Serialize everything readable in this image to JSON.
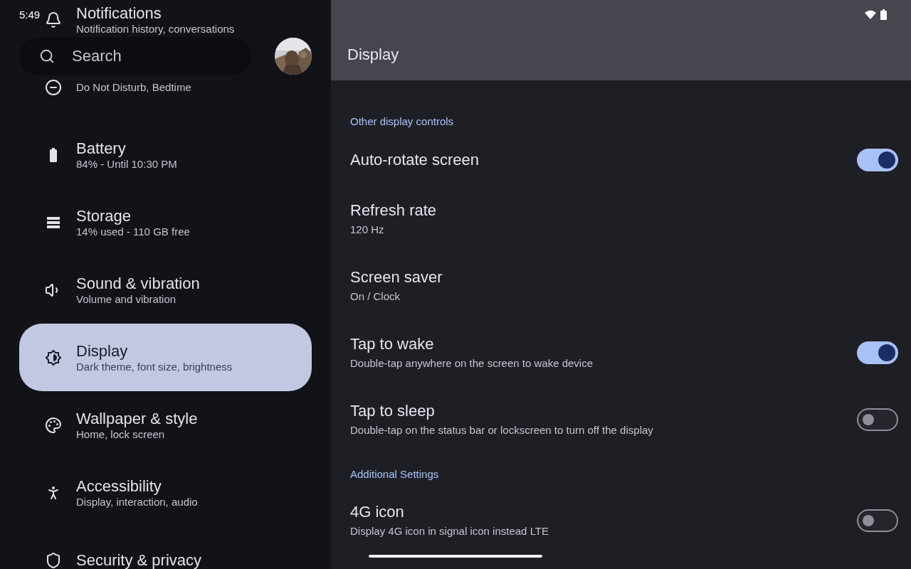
{
  "status_bar": {
    "time": "5:49"
  },
  "search": {
    "placeholder": "Search"
  },
  "sidebar": {
    "items": [
      {
        "title": "Notifications",
        "subtitle": "Notification history, conversations",
        "selected": false
      },
      {
        "subtitle": "Do Not Disturb, Bedtime",
        "selected": false
      },
      {
        "title": "Battery",
        "subtitle": "84% - Until 10:30 PM",
        "selected": false
      },
      {
        "title": "Storage",
        "subtitle": "14% used - 110 GB free",
        "selected": false
      },
      {
        "title": "Sound & vibration",
        "subtitle": "Volume and vibration",
        "selected": false
      },
      {
        "title": "Display",
        "subtitle": "Dark theme, font size, brightness",
        "selected": true
      },
      {
        "title": "Wallpaper & style",
        "subtitle": "Home, lock screen",
        "selected": false
      },
      {
        "title": "Accessibility",
        "subtitle": "Display, interaction, audio",
        "selected": false
      },
      {
        "title": "Security & privacy",
        "selected": false
      }
    ]
  },
  "header": {
    "title": "Display"
  },
  "sections": [
    {
      "title": "Other display controls",
      "rows": [
        {
          "kind": "switch",
          "title": "Auto-rotate screen",
          "on": true
        },
        {
          "kind": "text",
          "title": "Refresh rate",
          "subtitle": "120 Hz"
        },
        {
          "kind": "text",
          "title": "Screen saver",
          "subtitle": "On / Clock"
        },
        {
          "kind": "switch",
          "title": "Tap to wake",
          "subtitle": "Double-tap anywhere on the screen to wake device",
          "on": true
        },
        {
          "kind": "switch",
          "title": "Tap to sleep",
          "subtitle": "Double-tap on the status bar or lockscreen to turn off the display",
          "on": false
        }
      ]
    },
    {
      "title": "Additional Settings",
      "rows": [
        {
          "kind": "switch",
          "title": "4G icon",
          "subtitle": "Display 4G icon in signal icon instead LTE",
          "on": false
        }
      ]
    }
  ]
}
